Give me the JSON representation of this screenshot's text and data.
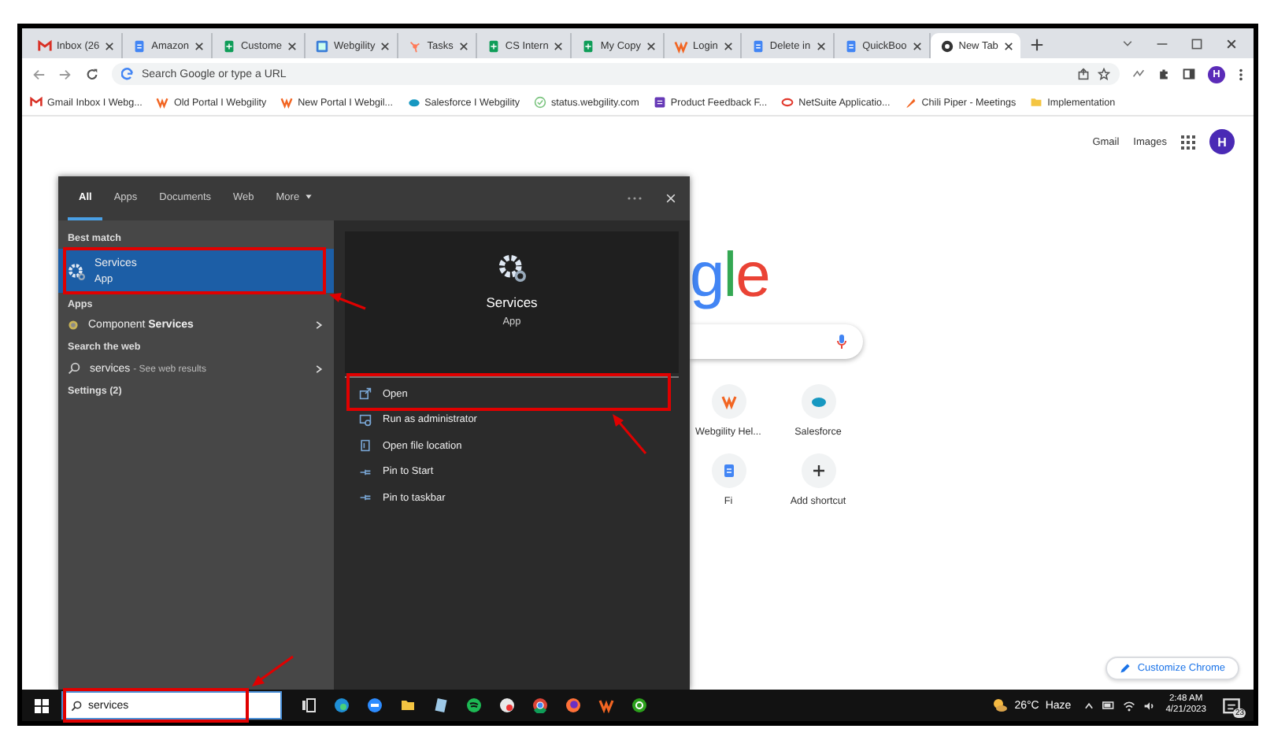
{
  "browser": {
    "tabs": [
      {
        "title": "Inbox (26",
        "selected": false
      },
      {
        "title": "Amazon",
        "selected": false
      },
      {
        "title": "Custome",
        "selected": false
      },
      {
        "title": "Webgility",
        "selected": false
      },
      {
        "title": "Tasks",
        "selected": false
      },
      {
        "title": "CS Intern",
        "selected": false
      },
      {
        "title": "My Copy",
        "selected": false
      },
      {
        "title": "Login",
        "selected": false
      },
      {
        "title": "Delete in",
        "selected": false
      },
      {
        "title": "QuickBoo",
        "selected": false
      },
      {
        "title": "New Tab",
        "selected": true
      }
    ],
    "omnibox": {
      "placeholder": "Search Google or type a URL"
    },
    "profile_initial": "H",
    "bookmarks": [
      {
        "label": "Gmail Inbox I Webg..."
      },
      {
        "label": "Old Portal I Webgility"
      },
      {
        "label": "New Portal I Webgil..."
      },
      {
        "label": "Salesforce I Webgility"
      },
      {
        "label": "status.webgility.com"
      },
      {
        "label": "Product Feedback F..."
      },
      {
        "label": "NetSuite Applicatio..."
      },
      {
        "label": "Chili Piper - Meetings"
      },
      {
        "label": "Implementation"
      }
    ]
  },
  "new_tab_page": {
    "header_links": [
      "Gmail",
      "Images"
    ],
    "avatar": "H",
    "logo": "gle",
    "shortcuts": [
      {
        "label": "Webgility Hel..."
      },
      {
        "label": "Salesforce"
      },
      {
        "label": "Fi"
      },
      {
        "label": "Add shortcut"
      }
    ],
    "customize_button": "Customize Chrome"
  },
  "start_menu": {
    "tabs": [
      {
        "label": "All",
        "selected": true
      },
      {
        "label": "Apps",
        "selected": false
      },
      {
        "label": "Documents",
        "selected": false
      },
      {
        "label": "Web",
        "selected": false
      },
      {
        "label": "More",
        "selected": false
      }
    ],
    "sections": [
      {
        "heading": "Best match",
        "results": [
          {
            "kind": "best",
            "title": "Services",
            "subtitle": "App",
            "selected": true
          }
        ]
      },
      {
        "heading": "Apps",
        "results": [
          {
            "kind": "app",
            "title": "Component **Services**",
            "selected": false
          }
        ]
      },
      {
        "heading": "Search the web",
        "results": [
          {
            "kind": "web",
            "title": "services",
            "subtitle": "- See web results",
            "selected": false
          }
        ]
      },
      {
        "heading": "Settings (2)"
      }
    ],
    "preview": {
      "title": "Services",
      "subtitle": "App",
      "actions": [
        {
          "label": "Open"
        },
        {
          "label": "Run as administrator"
        },
        {
          "label": "Open file location"
        },
        {
          "label": "Pin to Start"
        },
        {
          "label": "Pin to taskbar"
        }
      ]
    }
  },
  "taskbar": {
    "search": {
      "value": "services"
    },
    "weather": {
      "temperature": "26°C",
      "condition": "Haze"
    },
    "clock": {
      "time": "2:48 AM",
      "date": "4/21/2023"
    },
    "notifications": "23"
  }
}
